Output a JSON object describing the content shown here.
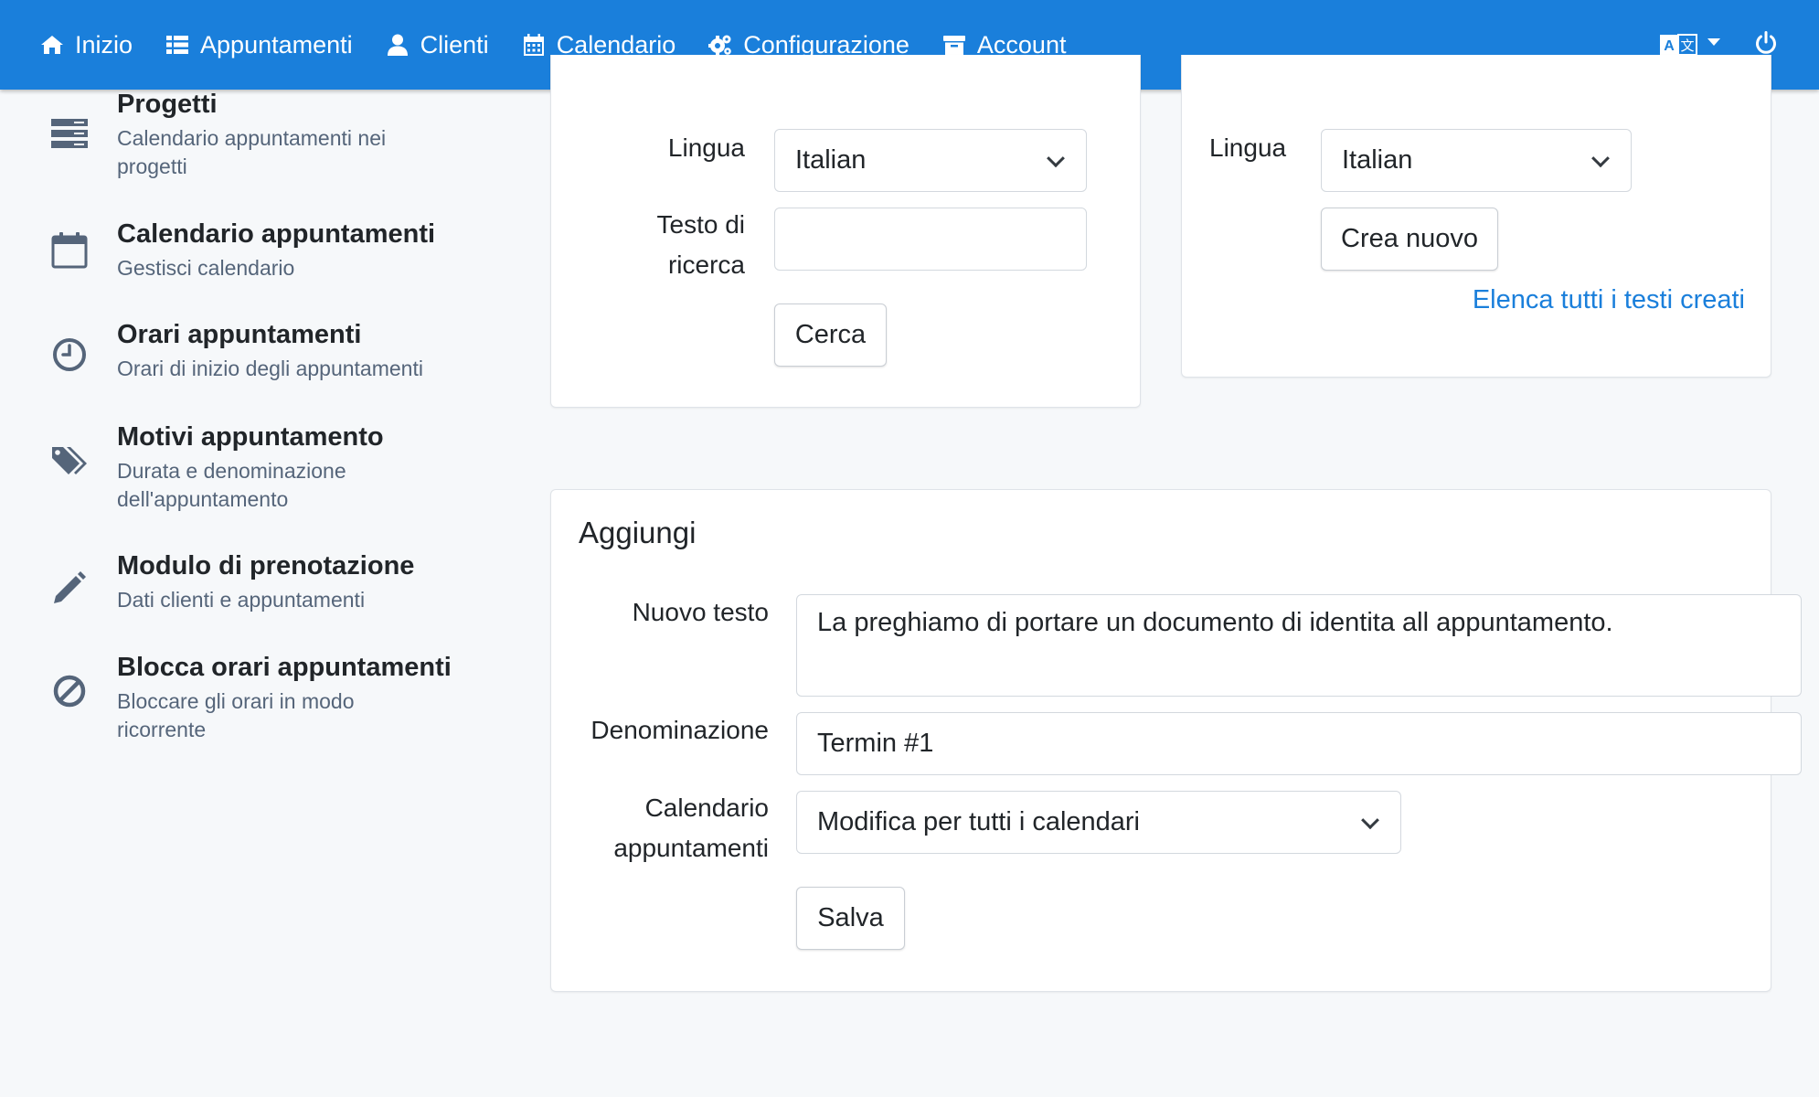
{
  "navbar": {
    "items": [
      {
        "label": "Inizio",
        "icon": "home-icon"
      },
      {
        "label": "Appuntamenti",
        "icon": "list-icon"
      },
      {
        "label": "Clienti",
        "icon": "user-icon"
      },
      {
        "label": "Calendario",
        "icon": "calendar-icon"
      },
      {
        "label": "Configurazione",
        "icon": "cogs-icon"
      },
      {
        "label": "Account",
        "icon": "archive-icon"
      }
    ],
    "language_icon": "language-icon",
    "power_icon": "power-icon",
    "color": "#1a7fdb"
  },
  "sidebar": {
    "items": [
      {
        "title": "Progetti",
        "subtitle": "Calendario appuntamenti nei progetti",
        "icon": "server-icon"
      },
      {
        "title": "Calendario appuntamenti",
        "subtitle": "Gestisci calendario",
        "icon": "calendar-outline-icon"
      },
      {
        "title": "Orari appuntamenti",
        "subtitle": "Orari di inizio degli appuntamenti",
        "icon": "clock-icon"
      },
      {
        "title": "Motivi appuntamento",
        "subtitle": "Durata e denominazione dell'appuntamento",
        "icon": "tags-icon"
      },
      {
        "title": "Modulo di prenotazione",
        "subtitle": "Dati clienti e appuntamenti",
        "icon": "pencil-icon"
      },
      {
        "title": "Blocca orari appuntamenti",
        "subtitle": "Bloccare gli orari in modo ricorrente",
        "icon": "ban-icon"
      }
    ]
  },
  "search_card": {
    "language_label": "Lingua",
    "language_value": "Italian",
    "search_label": "Testo di ricerca",
    "search_value": "",
    "search_button": "Cerca"
  },
  "create_card": {
    "language_label": "Lingua",
    "language_value": "Italian",
    "create_button": "Crea nuovo",
    "list_link": "Elenca tutti i testi creati"
  },
  "add_card": {
    "title": "Aggiungi",
    "new_text_label": "Nuovo testo",
    "new_text_value": "La preghiamo di portare un documento di identita all appuntamento.",
    "name_label": "Denominazione",
    "name_value": "Termin #1",
    "calendar_label": "Calendario appuntamenti",
    "calendar_value": "Modifica per tutti i calendari",
    "save_button": "Salva"
  }
}
